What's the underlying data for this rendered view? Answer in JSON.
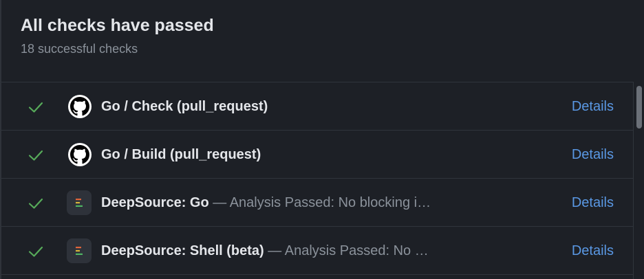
{
  "header": {
    "title": "All checks have passed",
    "subtitle": "18 successful checks"
  },
  "colors": {
    "success": "#57ab5a",
    "link": "#5a98e4"
  },
  "checks": [
    {
      "status_icon": "check-icon",
      "app_icon": "github-icon",
      "name": "Go / Check (pull_request)",
      "description": "",
      "details_label": "Details"
    },
    {
      "status_icon": "check-icon",
      "app_icon": "github-icon",
      "name": "Go / Build (pull_request)",
      "description": "",
      "details_label": "Details"
    },
    {
      "status_icon": "check-icon",
      "app_icon": "deepsource-icon",
      "name": "DeepSource: Go",
      "description": " — Analysis Passed: No blocking i…",
      "details_label": "Details"
    },
    {
      "status_icon": "check-icon",
      "app_icon": "deepsource-icon",
      "name": "DeepSource: Shell (beta)",
      "description": " — Analysis Passed: No …",
      "details_label": "Details"
    }
  ]
}
